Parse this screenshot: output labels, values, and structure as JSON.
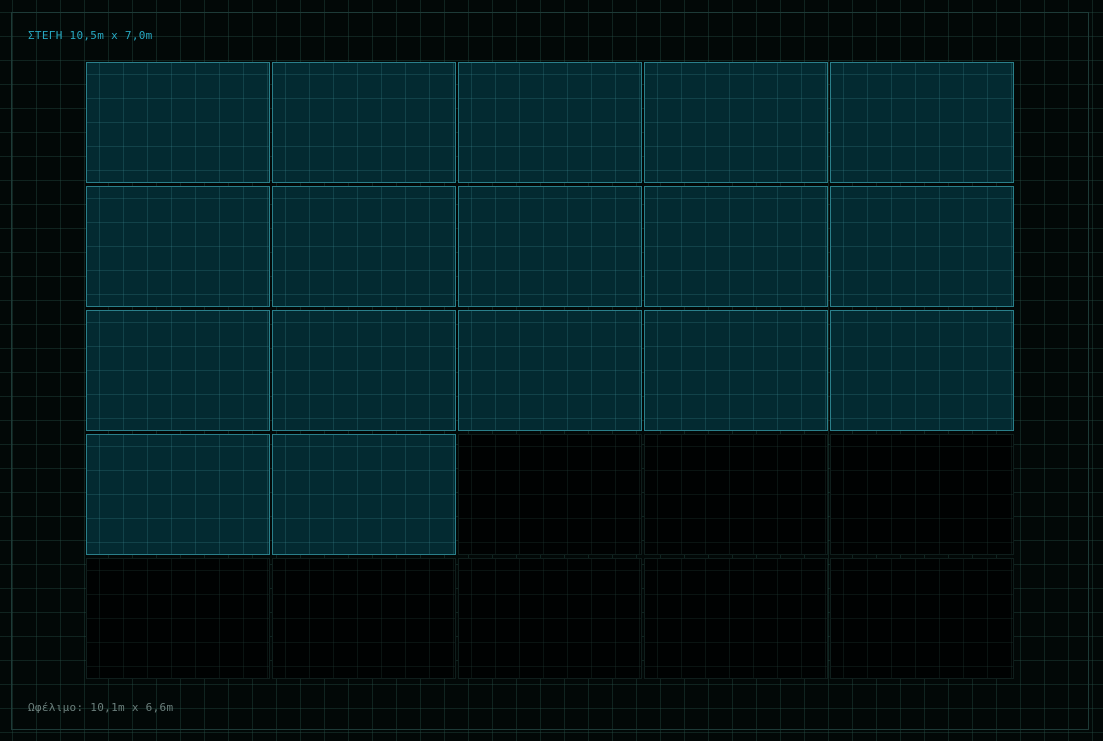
{
  "roof": {
    "title": "ΣΤΕΓΗ 10,5m x 7,0m",
    "usable": "Ωφέλιμο: 10,1m x 6,6m"
  },
  "layout": {
    "columns": 5,
    "rows": 5,
    "filled_slots": 17,
    "total_slots": 25
  },
  "colors": {
    "background": "#020807",
    "title": "#27a7c0",
    "usable_label": "#6b7f7c",
    "panel_fill": "#032a31",
    "panel_border": "#2a7f8a",
    "empty_slot": "#000202"
  }
}
